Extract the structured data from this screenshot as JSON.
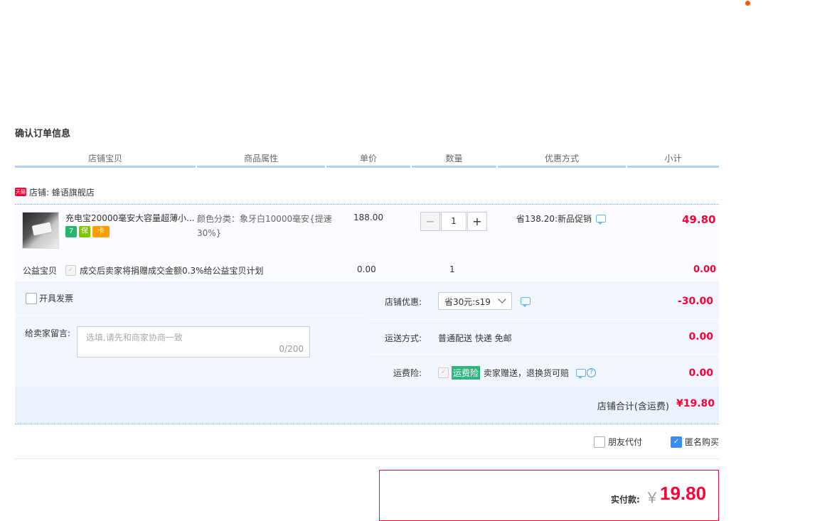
{
  "section_title": "确认订单信息",
  "columns": [
    "店铺宝贝",
    "商品属性",
    "单价",
    "数量",
    "优惠方式",
    "小计"
  ],
  "shop": {
    "badge": "天猫",
    "name": "店铺: 蜂语旗舰店"
  },
  "item": {
    "title": "充电宝20000毫安大容量超薄小...",
    "attr": "颜色分类：象牙白10000毫安{提速30%}",
    "price": "188.00",
    "quantity": "1",
    "promo": "省138.20:新品促销",
    "subtotal": "49.80",
    "badges": [
      "7",
      "保",
      "卡"
    ]
  },
  "charity": {
    "label": "公益宝贝",
    "text": "成交后卖家将捐赠成交金额0.3%给公益宝贝计划",
    "price": "0.00",
    "qty": "1",
    "subtotal": "0.00"
  },
  "invoice_label": "开具发票",
  "note": {
    "label": "给卖家留言:",
    "placeholder": "选填,请先和商家协商一致",
    "count": "0/200"
  },
  "shop_discount": {
    "label": "店铺优惠:",
    "selected": "省30元:s19",
    "value": "-30.00"
  },
  "shipping": {
    "label": "运送方式:",
    "text": "普通配送 快递 免邮",
    "value": "0.00"
  },
  "insurance": {
    "label": "运费险:",
    "tag": "运费险",
    "text": "卖家赠送，退换货可赔",
    "value": "0.00"
  },
  "shop_total": {
    "label": "店铺合计(含运费)",
    "amount": "¥19.80"
  },
  "options": {
    "friend_pay": "朋友代付",
    "anonymous": "匿名购买"
  },
  "payment": {
    "label": "实付款:",
    "currency": "￥",
    "amount": "19.80"
  },
  "colors": {
    "accent": "#ff0036",
    "header_line": "#b2d1ff",
    "panel": "#f2f7ff"
  }
}
